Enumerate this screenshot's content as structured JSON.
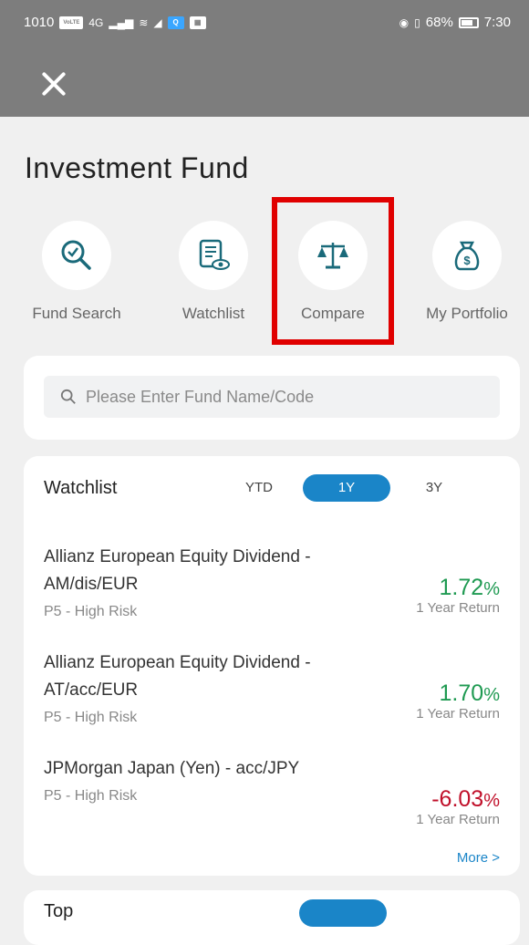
{
  "status_bar": {
    "left_text": "1010",
    "volte": "VoLTE",
    "signal": "4G",
    "battery_text": "68%",
    "time": "7:30"
  },
  "header": {
    "title": "Investment Fund"
  },
  "quick_nav": [
    {
      "label": "Fund Search",
      "icon": "search-check-icon"
    },
    {
      "label": "Watchlist",
      "icon": "document-eye-icon"
    },
    {
      "label": "Compare",
      "icon": "scale-icon"
    },
    {
      "label": "My Portfolio",
      "icon": "money-bag-icon"
    }
  ],
  "search": {
    "placeholder": "Please Enter Fund Name/Code"
  },
  "watchlist": {
    "title": "Watchlist",
    "tabs": [
      "YTD",
      "1Y",
      "3Y"
    ],
    "active_tab": "1Y",
    "funds": [
      {
        "name": "Allianz European Equity Dividend - AM/dis/EUR",
        "risk": "P5 - High Risk",
        "return_value": "1.72",
        "return_unit": "%",
        "return_label": "1 Year Return",
        "sign": "positive"
      },
      {
        "name": "Allianz European Equity Dividend - AT/acc/EUR",
        "risk": "P5 - High Risk",
        "return_value": "1.70",
        "return_unit": "%",
        "return_label": "1 Year Return",
        "sign": "positive"
      },
      {
        "name": "JPMorgan Japan (Yen) - acc/JPY",
        "risk": "P5 - High Risk",
        "return_value": "-6.03",
        "return_unit": "%",
        "return_label": "1 Year Return",
        "sign": "negative"
      }
    ],
    "more_label": "More >"
  },
  "top_section": {
    "title": "Top"
  },
  "colors": {
    "accent": "#1a85c8",
    "positive": "#1f9a52",
    "negative": "#c0102a",
    "highlight": "#e00000"
  }
}
